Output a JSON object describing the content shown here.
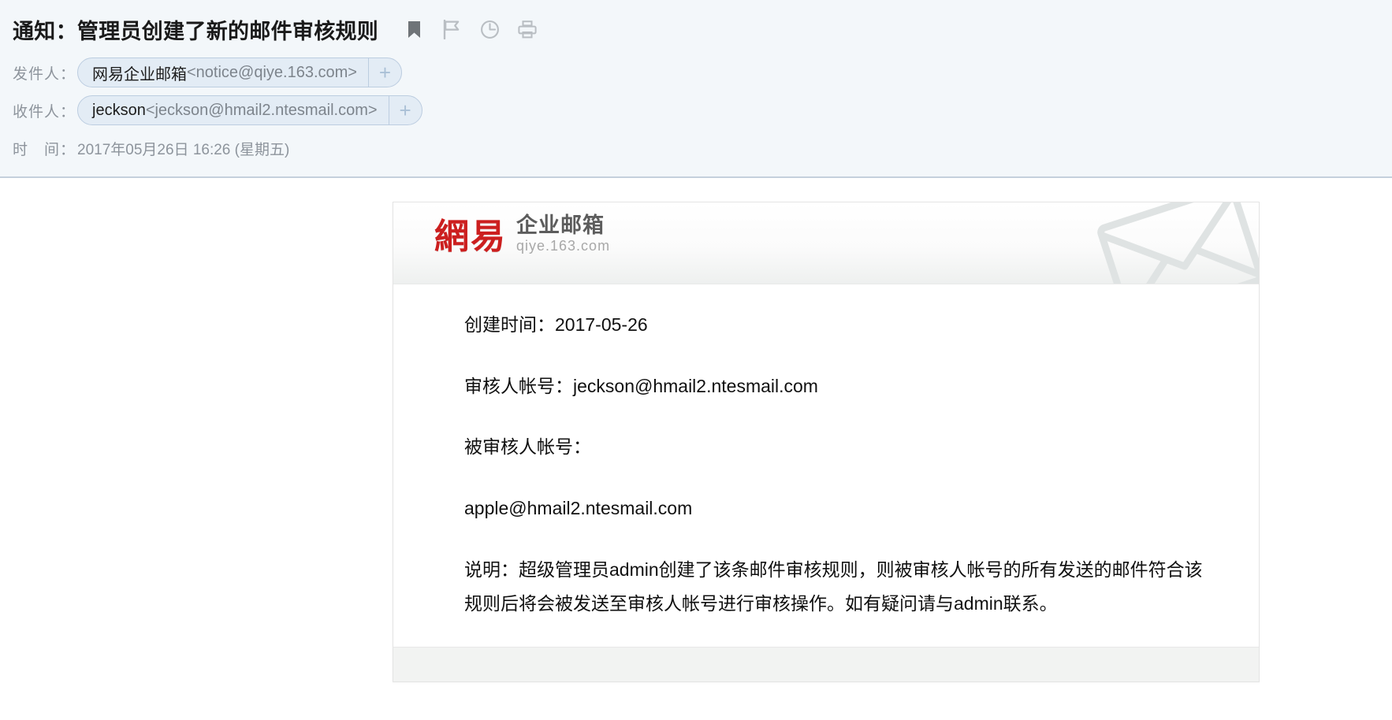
{
  "header": {
    "subject": "通知：管理员创建了新的邮件审核规则",
    "icons": [
      {
        "name": "bookmark-icon",
        "label": "标记"
      },
      {
        "name": "flag-icon",
        "label": "旗标"
      },
      {
        "name": "clock-icon",
        "label": "定时"
      },
      {
        "name": "print-icon",
        "label": "打印"
      }
    ],
    "from": {
      "label": "发件人：",
      "name": "网易企业邮箱",
      "email": "<notice@qiye.163.com>",
      "add_label": "+"
    },
    "to": {
      "label": "收件人：",
      "name": "jeckson",
      "email": "<jeckson@hmail2.ntesmail.com>",
      "add_label": "+"
    },
    "date": {
      "label": "时　间：",
      "value": "2017年05月26日 16:26 (星期五)"
    }
  },
  "body": {
    "brand": {
      "logo_cn": "網易",
      "subtitle": "企业邮箱",
      "url": "qiye.163.com"
    },
    "paragraphs": [
      "创建时间：2017-05-26",
      "审核人帐号：jeckson@hmail2.ntesmail.com",
      "被审核人帐号：",
      "apple@hmail2.ntesmail.com",
      "说明：超级管理员admin创建了该条邮件审核规则，则被审核人帐号的所有发送的邮件符合该规则后将会被发送至审核人帐号进行审核操作。如有疑问请与admin联系。"
    ]
  },
  "colors": {
    "header_bg": "#f3f7fa",
    "divider": "#c5d0dc",
    "pill_bg": "#e3ecf5",
    "pill_border": "#bccde0",
    "brand_red": "#cc1f1f",
    "muted_text": "#8d949c"
  }
}
